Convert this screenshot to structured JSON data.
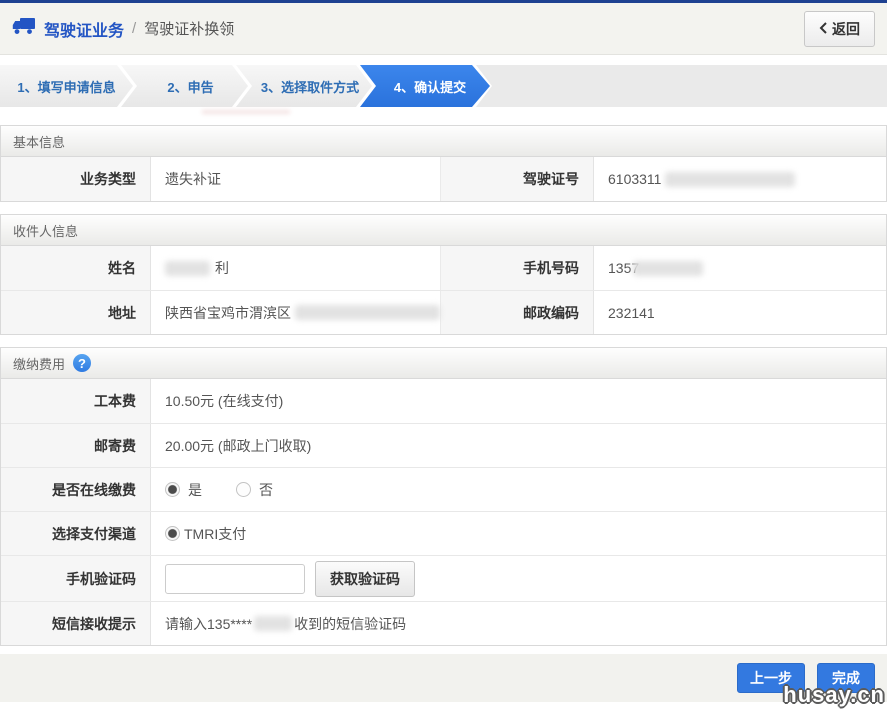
{
  "colors": {
    "top_bar": "#1e4191",
    "title_blue": "#2355c4",
    "step_active_blue": "#2f7be2",
    "step_text_blue": "#2e6db4",
    "button_blue": "#3379e0",
    "hint_tan": "#c9a26b"
  },
  "header": {
    "title": "驾驶证业务",
    "divider": "/",
    "subtitle": "驾驶证补换领",
    "back_label": "返回"
  },
  "steps": [
    {
      "label": "1、填写申请信息",
      "active": false
    },
    {
      "label": "2、申告",
      "active": false
    },
    {
      "label": "3、选择取件方式",
      "active": false
    },
    {
      "label": "4、确认提交",
      "active": true
    }
  ],
  "basic_info": {
    "section_title": "基本信息",
    "business_type_label": "业务类型",
    "business_type_value": "遗失补证",
    "license_no_label": "驾驶证号",
    "license_no_visible": "6103311"
  },
  "recipient_info": {
    "section_title": "收件人信息",
    "name_label": "姓名",
    "name_visible": "利",
    "phone_label": "手机号码",
    "phone_visible": "1357",
    "address_label": "地址",
    "address_visible": "陕西省宝鸡市渭滨区",
    "postcode_label": "邮政编码",
    "postcode_value": "232141"
  },
  "payment": {
    "section_title": "缴纳费用",
    "help_icon": "?",
    "fee_label": "工本费",
    "fee_value": "10.50元 (在线支付)",
    "postage_label": "邮寄费",
    "postage_value": "20.00元 (邮政上门收取)",
    "online_pay_label": "是否在线缴费",
    "online_pay_yes": "是",
    "online_pay_no": "否",
    "online_pay_selected": "是",
    "channel_label": "选择支付渠道",
    "channel_option": "TMRI支付",
    "captcha_label": "手机验证码",
    "captcha_input_value": "",
    "captcha_button": "获取验证码",
    "sms_tip_label": "短信接收提示",
    "sms_tip_prefix": "请输入135****",
    "sms_tip_suffix": "收到的短信验证码"
  },
  "footer": {
    "prev_button": "上一步",
    "finish_button": "完成"
  },
  "watermark": "husay.cn"
}
